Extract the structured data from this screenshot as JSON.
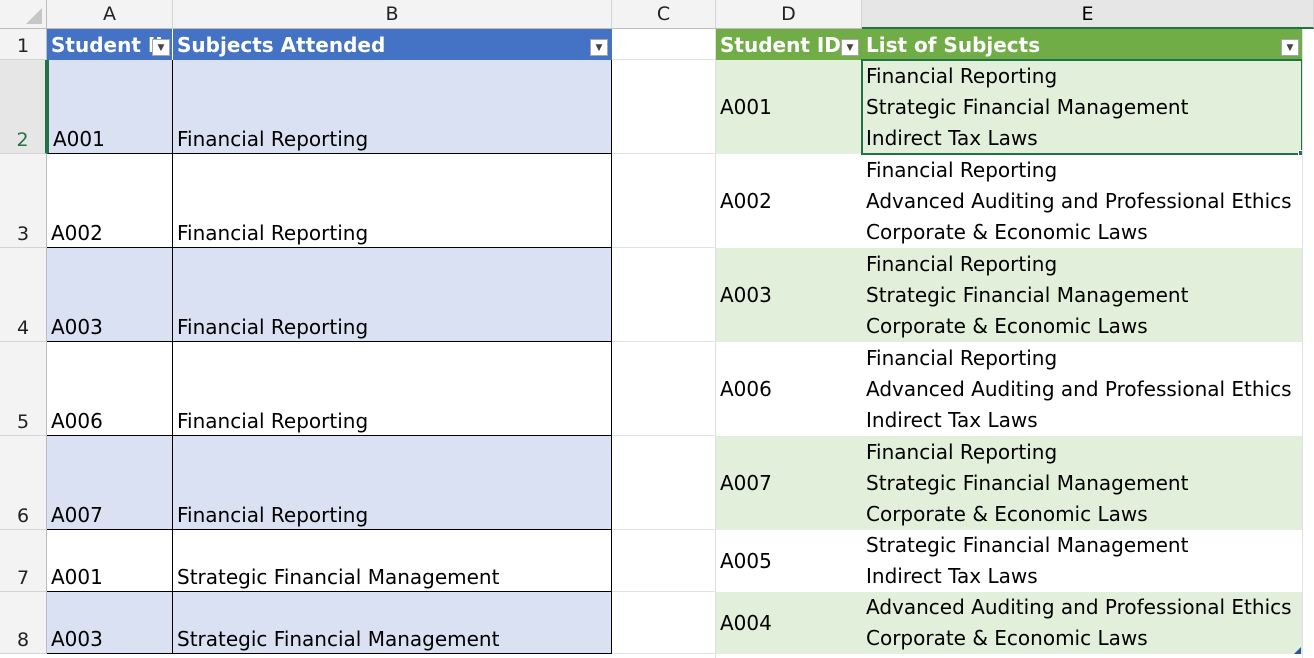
{
  "columns": [
    "A",
    "B",
    "C",
    "D",
    "E"
  ],
  "rows": [
    "1",
    "2",
    "3",
    "4",
    "5",
    "6",
    "7",
    "8"
  ],
  "table1": {
    "headers": [
      "Student ID",
      "Subjects Attended"
    ],
    "header_a_visible": "Student II",
    "rows": [
      {
        "id": "A001",
        "subject": "Financial Reporting"
      },
      {
        "id": "A002",
        "subject": "Financial Reporting"
      },
      {
        "id": "A003",
        "subject": "Financial Reporting"
      },
      {
        "id": "A006",
        "subject": "Financial Reporting"
      },
      {
        "id": "A007",
        "subject": "Financial Reporting"
      },
      {
        "id": "A001",
        "subject": "Strategic Financial Management"
      },
      {
        "id": "A003",
        "subject": "Strategic Financial Management"
      }
    ]
  },
  "table2": {
    "headers": [
      "Student ID",
      "List of Subjects"
    ],
    "rows": [
      {
        "id": "A001",
        "subjects": [
          "Financial Reporting",
          "Strategic Financial Management",
          "Indirect Tax Laws"
        ]
      },
      {
        "id": "A002",
        "subjects": [
          "Financial Reporting",
          "Advanced Auditing and Professional Ethics",
          "Corporate & Economic Laws"
        ]
      },
      {
        "id": "A003",
        "subjects": [
          "Financial Reporting",
          "Strategic Financial Management",
          "Corporate & Economic Laws"
        ]
      },
      {
        "id": "A006",
        "subjects": [
          "Financial Reporting",
          "Advanced Auditing and Professional Ethics",
          "Indirect Tax Laws"
        ]
      },
      {
        "id": "A007",
        "subjects": [
          "Financial Reporting",
          "Strategic Financial Management",
          "Corporate & Economic Laws"
        ]
      },
      {
        "id": "A005",
        "subjects": [
          "Strategic Financial Management",
          "Indirect Tax Laws"
        ]
      },
      {
        "id": "A004",
        "subjects": [
          "Advanced Auditing and Professional Ethics",
          "Corporate & Economic Laws"
        ]
      }
    ]
  },
  "colors": {
    "table1_header": "#4472c4",
    "table1_band": "#d9e1f2",
    "table2_header": "#70ad47",
    "table2_band": "#e2efda",
    "selection": "#217346"
  },
  "icons": {
    "filter": "filter-dropdown-icon",
    "select_all": "select-all-corner-icon"
  }
}
